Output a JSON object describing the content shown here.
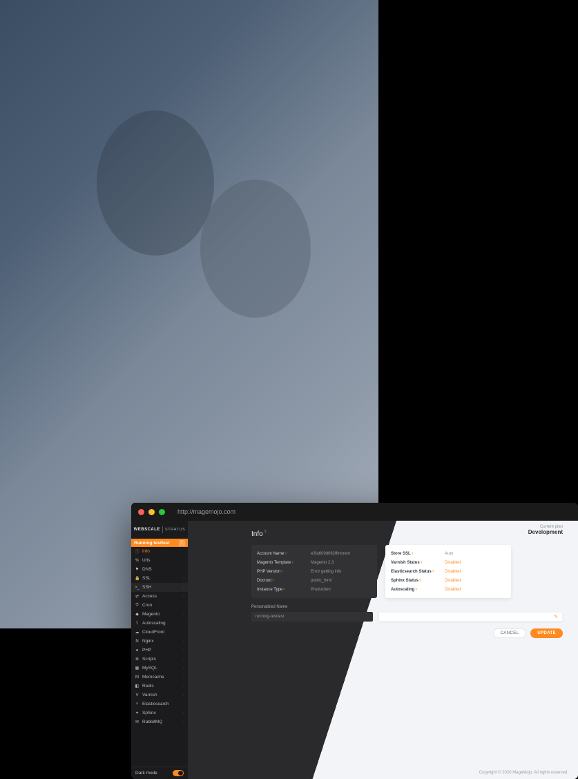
{
  "browser": {
    "url": "http://magemojo.com"
  },
  "brand": {
    "name": "WEBSCALE",
    "sub": "STRATUS"
  },
  "banner": {
    "label": "Running-testtest",
    "badge": "!"
  },
  "sidebar": {
    "items": [
      {
        "icon": "ⓘ",
        "label": "Info",
        "active": true,
        "chev": false
      },
      {
        "icon": "%",
        "label": "Urls",
        "chev": false
      },
      {
        "icon": "⚑",
        "label": "DNS",
        "chev": false
      },
      {
        "icon": "🔒",
        "label": "SSL",
        "chev": true
      },
      {
        "icon": ">_",
        "label": "SSH",
        "chev": true,
        "hover": true
      },
      {
        "icon": "⇄",
        "label": "Access",
        "chev": true
      },
      {
        "icon": "⏱",
        "label": "Cron",
        "chev": false
      },
      {
        "icon": "◆",
        "label": "Magento",
        "chev": true
      },
      {
        "icon": "⇪",
        "label": "Autoscaling",
        "chev": false
      },
      {
        "icon": "☁",
        "label": "CloudFront",
        "chev": true
      },
      {
        "icon": "N",
        "label": "Nginx",
        "chev": true
      },
      {
        "icon": "●",
        "label": "PHP",
        "chev": true
      },
      {
        "icon": "≣",
        "label": "Scripts",
        "chev": true
      },
      {
        "icon": "▦",
        "label": "MySQL",
        "chev": true
      },
      {
        "icon": "M",
        "label": "Memcache",
        "chev": true
      },
      {
        "icon": "◧",
        "label": "Redis",
        "chev": true
      },
      {
        "icon": "V",
        "label": "Varnish",
        "chev": true
      },
      {
        "icon": "⌕",
        "label": "Elasticsearch",
        "chev": true
      },
      {
        "icon": "✦",
        "label": "Sphinx",
        "chev": true
      },
      {
        "icon": "✉",
        "label": "RabbitMQ",
        "chev": true
      }
    ],
    "dark_mode_label": "Dark mode"
  },
  "header": {
    "title": "Info",
    "current_plan_label": "Current plan",
    "current_plan_value": "Development"
  },
  "info_panel": {
    "rows": [
      {
        "k": "Account Name",
        "v": "e3fa609d062ffmorem"
      },
      {
        "k": "Magento Template",
        "v": "Magento 2.3"
      },
      {
        "k": "PHP Version",
        "v": "Error getting info"
      },
      {
        "k": "Docroot",
        "v": "public_html"
      },
      {
        "k": "Instance Type",
        "v": "Production"
      }
    ]
  },
  "status_panel": {
    "rows": [
      {
        "k": "Store SSL",
        "v": "Auto",
        "muted": true
      },
      {
        "k": "Varnish Status",
        "v": "Disabled"
      },
      {
        "k": "Elasticsearch Status",
        "v": "Disabled"
      },
      {
        "k": "Sphinx Status",
        "v": "Disabled"
      },
      {
        "k": "Autoscaling",
        "v": "Disabled"
      }
    ]
  },
  "personalized": {
    "label": "Personalized Name",
    "value": "running-testtest"
  },
  "buttons": {
    "cancel": "CANCEL",
    "update": "UPDATE"
  },
  "footer": {
    "copyright": "Copyright © 2020 MageMojo. All rights reserved."
  }
}
